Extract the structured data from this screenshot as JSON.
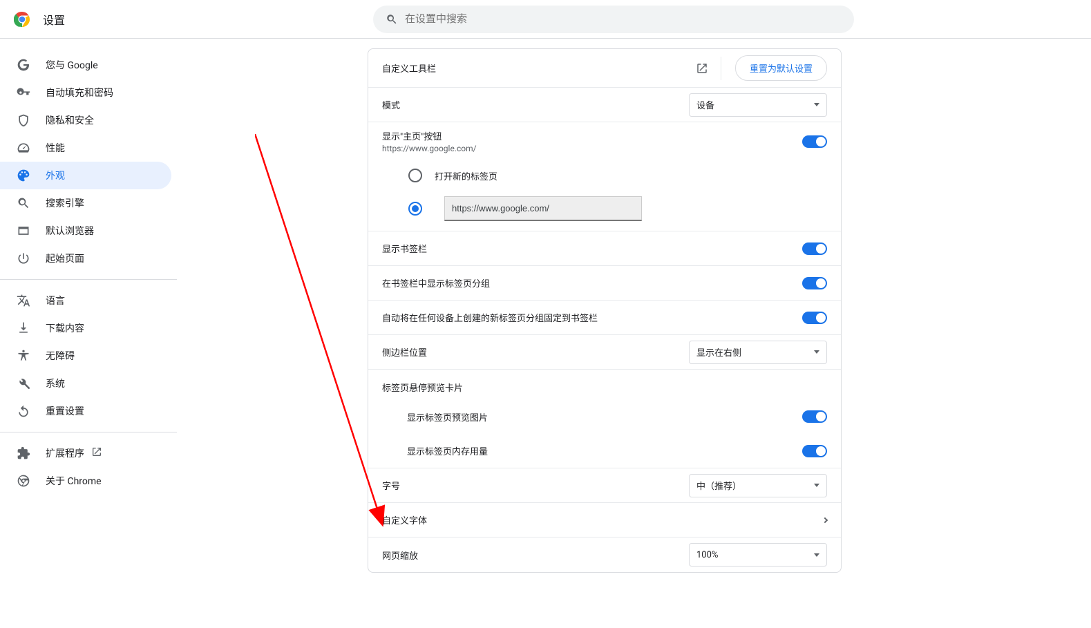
{
  "header": {
    "title": "设置",
    "search_placeholder": "在设置中搜索"
  },
  "sidebar": {
    "items": [
      {
        "label": "您与 Google"
      },
      {
        "label": "自动填充和密码"
      },
      {
        "label": "隐私和安全"
      },
      {
        "label": "性能"
      },
      {
        "label": "外观"
      },
      {
        "label": "搜索引擎"
      },
      {
        "label": "默认浏览器"
      },
      {
        "label": "起始页面"
      }
    ],
    "items2": [
      {
        "label": "语言"
      },
      {
        "label": "下载内容"
      },
      {
        "label": "无障碍"
      },
      {
        "label": "系统"
      },
      {
        "label": "重置设置"
      }
    ],
    "items3": [
      {
        "label": "扩展程序"
      },
      {
        "label": "关于 Chrome"
      }
    ]
  },
  "content": {
    "toolbar_label": "自定义工具栏",
    "reset_label": "重置为默认设置",
    "mode_label": "模式",
    "mode_value": "设备",
    "home_button_label": "显示\"主页\"按钮",
    "home_button_sub": "https://www.google.com/",
    "radio_newtab": "打开新的标签页",
    "radio_url_value": "https://www.google.com/",
    "show_bookmarks": "显示书签栏",
    "show_tab_groups": "在书签栏中显示标签页分组",
    "auto_pin_groups": "自动将在任何设备上创建的新标签页分组固定到书签栏",
    "sidepanel_label": "侧边栏位置",
    "sidepanel_value": "显示在右侧",
    "hover_section": "标签页悬停预览卡片",
    "hover_preview_img": "显示标签页预览图片",
    "hover_memory": "显示标签页内存用量",
    "font_size_label": "字号",
    "font_size_value": "中（推荐）",
    "custom_font_label": "自定义字体",
    "page_zoom_label": "网页缩放",
    "page_zoom_value": "100%"
  }
}
